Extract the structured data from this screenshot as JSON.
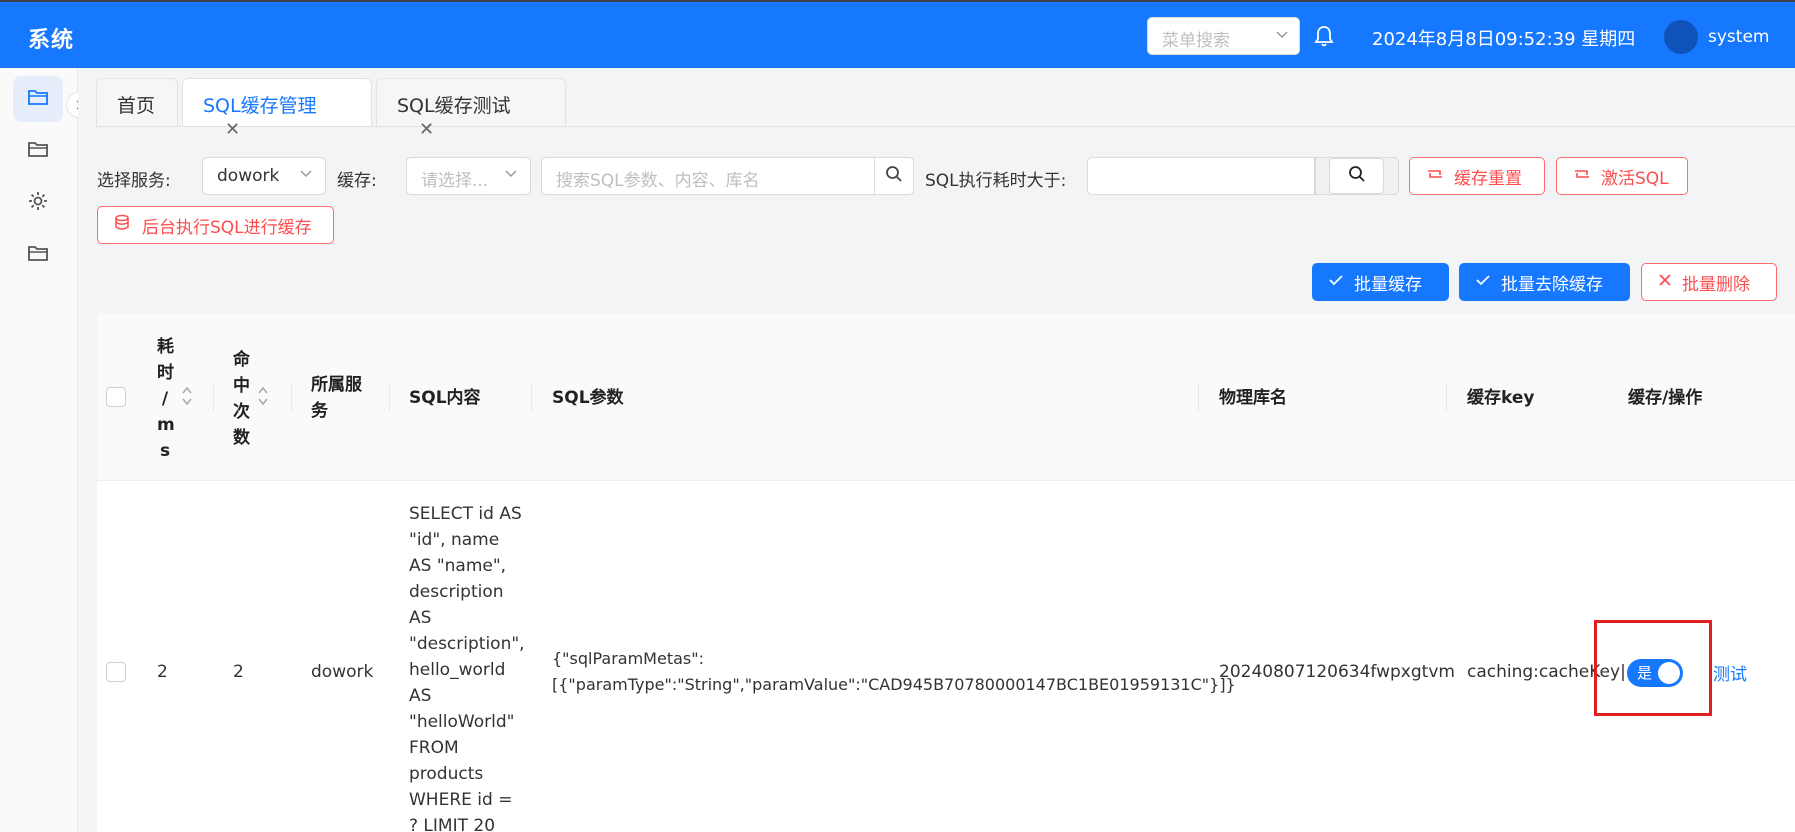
{
  "header": {
    "brand": "系统",
    "menu_search_placeholder": "菜单搜索",
    "datetime": "2024年8月8日09:52:39 星期四",
    "username": "system"
  },
  "rail": {
    "items": [
      "folder-icon",
      "folder-icon",
      "gear-icon",
      "folder-icon"
    ]
  },
  "tabs": [
    {
      "label": "首页",
      "active": false,
      "closable": false
    },
    {
      "label": "SQL缓存管理",
      "active": true,
      "closable": true
    },
    {
      "label": "SQL缓存测试",
      "active": false,
      "closable": true
    }
  ],
  "filters": {
    "service_label": "选择服务:",
    "service_value": "dowork",
    "cache_label": "缓存:",
    "cache_placeholder": "请选择...",
    "search_placeholder": "搜索SQL参数、内容、库名",
    "exec_time_label": "SQL执行耗时大于:",
    "exec_time_value": "",
    "reset_cache_label": "缓存重置",
    "activate_sql_label": "激活SQL",
    "background_exec_label": "后台执行SQL进行缓存"
  },
  "batch_actions": {
    "batch_cache": "批量缓存",
    "batch_uncache": "批量去除缓存",
    "batch_delete": "批量删除"
  },
  "table": {
    "columns": {
      "elapsed": [
        "耗",
        "时",
        "/",
        "m",
        "s"
      ],
      "hits": [
        "命",
        "中",
        "次",
        "数"
      ],
      "service": [
        "所属服",
        "务"
      ],
      "sql_content": "SQL内容",
      "sql_params": "SQL参数",
      "db_name": "物理库名",
      "cache_key": "缓存key",
      "cache_ops": "缓存/操作"
    },
    "rows": [
      {
        "elapsed": "2",
        "hits": "2",
        "service": "dowork",
        "sql_content_lines": [
          "SELECT id AS",
          "\"id\", name",
          "AS \"name\",",
          "description",
          "AS",
          "\"description\",",
          "hello_world",
          "AS",
          "\"helloWorld\"",
          "FROM",
          "products",
          "WHERE id =",
          "? LIMIT 20"
        ],
        "sql_params_lines": [
          "{\"sqlParamMetas\":",
          "[{\"paramType\":\"String\",\"paramValue\":\"CAD945B70780000147BC1BE01959131C\"}]}"
        ],
        "db_name": "20240807120634fwpxgtvm",
        "cache_key": "caching:cacheKey|.",
        "cache_switch_label": "是",
        "cache_switch_on": true,
        "test_link": "测试"
      }
    ]
  },
  "colors": {
    "primary": "#1677ff",
    "danger": "#ff4d4f",
    "highlight": "#e02020"
  }
}
